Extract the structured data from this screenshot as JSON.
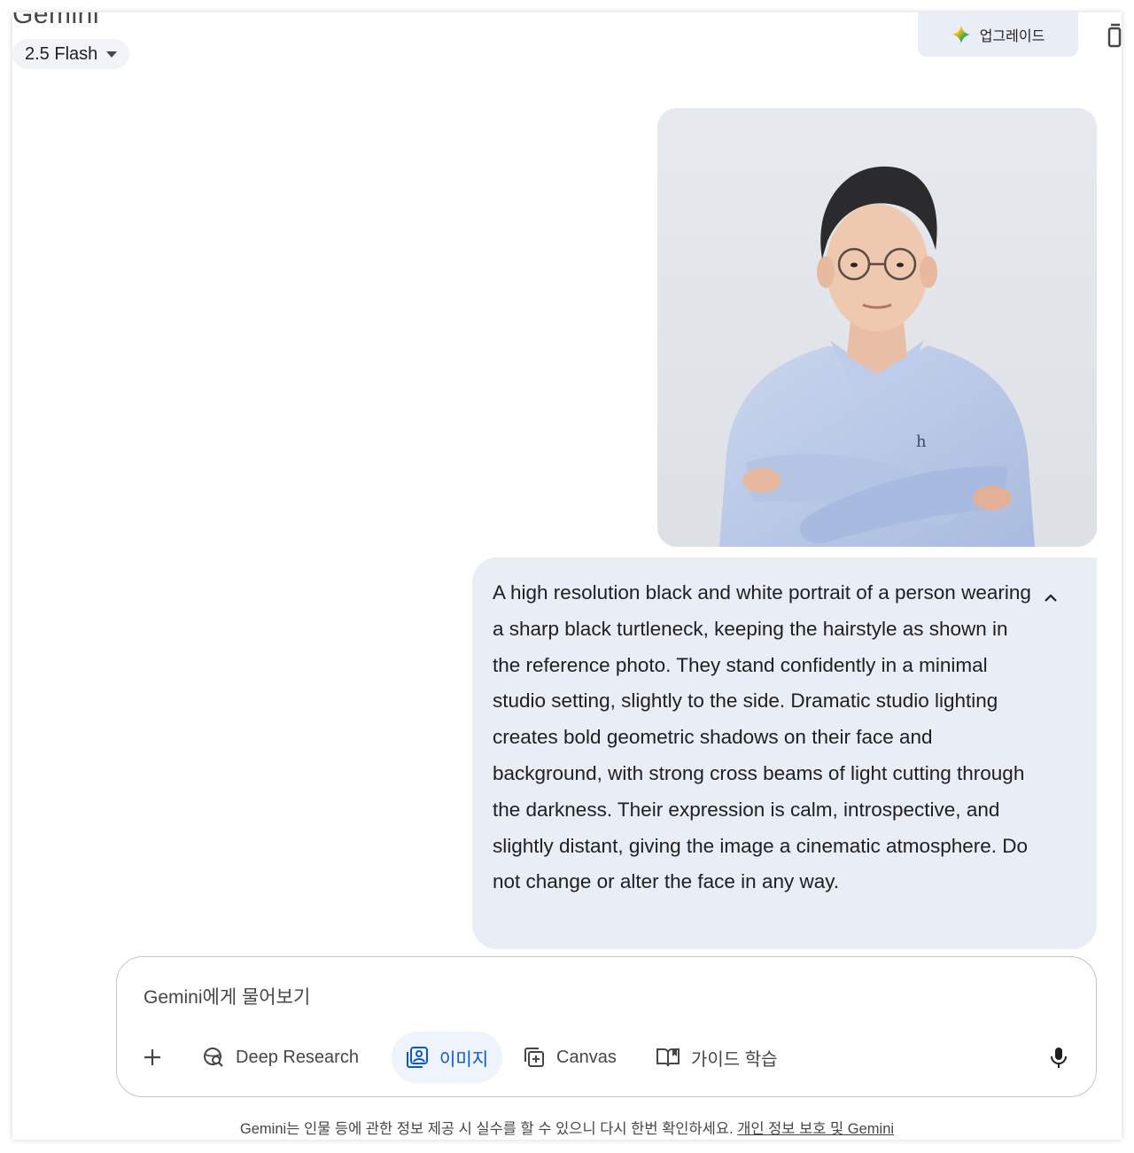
{
  "app": {
    "title": "Gemini"
  },
  "model_picker": {
    "label": "2.5 Flash"
  },
  "header": {
    "upgrade_label": "업그레이드"
  },
  "conversation": {
    "user_prompt": "A high resolution black and white portrait of a person wearing a sharp black turtleneck, keeping the hairstyle as shown in the reference photo. They stand confidently in a minimal studio setting, slightly to the side. Dramatic studio lighting creates bold geometric shadows on their face and background, with strong cross beams of light cutting through the darkness. Their expression is calm, introspective, and slightly distant, giving the image a cinematic atmosphere. Do not change or alter the face in any way."
  },
  "input": {
    "placeholder": "Gemini에게 물어보기"
  },
  "tools": {
    "deep_research": "Deep Research",
    "image": "이미지",
    "canvas": "Canvas",
    "guided_learning": "가이드 학습"
  },
  "footer": {
    "disclaimer": "Gemini는 인물 등에 관한 정보 제공 시 실수를 할 수 있으니 다시 한번 확인하세요.",
    "privacy_link": "개인 정보 보호 및 Gemini"
  },
  "colors": {
    "accent": "#0b57d0",
    "bubble": "#e9eef6",
    "chip": "#f0f4f9"
  }
}
